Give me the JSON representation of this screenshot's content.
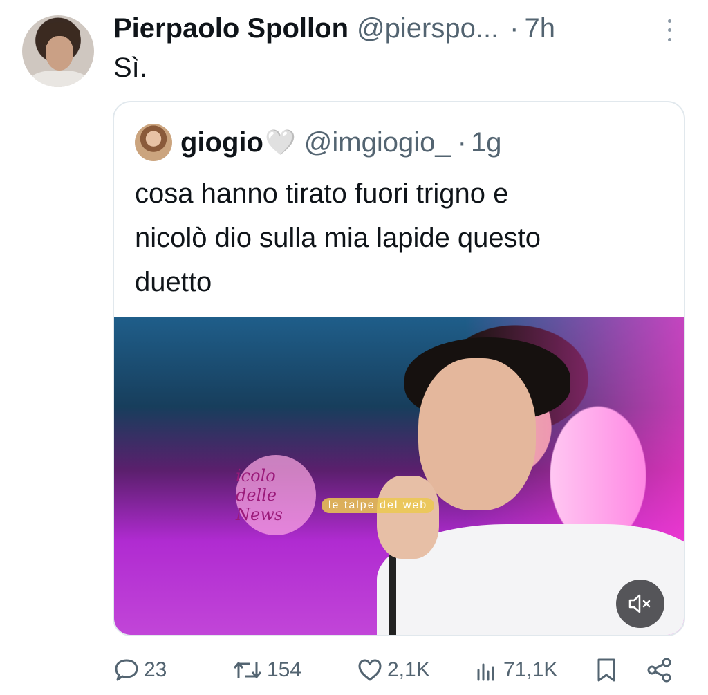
{
  "tweet": {
    "name": "Pierpaolo Spollon",
    "handle": "@pierspo...",
    "dot": "·",
    "time": "7h",
    "text": "Sì."
  },
  "quote": {
    "name": "giogio",
    "heart": "🤍",
    "handle": "@imgiogio_",
    "dot": "·",
    "time": "1g",
    "text_lines": [
      "cosa hanno tirato fuori trigno e",
      "nicolò dio sulla mia lapide questo",
      "duetto"
    ]
  },
  "watermark": {
    "circle": "icolo delle News",
    "banner": "le talpe del web"
  },
  "actions": {
    "replies": "23",
    "retweets": "154",
    "likes": "2,1K",
    "views": "71,1K"
  },
  "icons": {
    "reply": "reply-icon",
    "retweet": "retweet-icon",
    "like": "heart-icon",
    "views": "views-icon",
    "bookmark": "bookmark-icon",
    "share": "share-icon",
    "mute": "mute-icon",
    "more": "more-icon"
  },
  "colors": {
    "text": "#0f1419",
    "secondary": "#536471",
    "border": "#e1e8ed"
  }
}
